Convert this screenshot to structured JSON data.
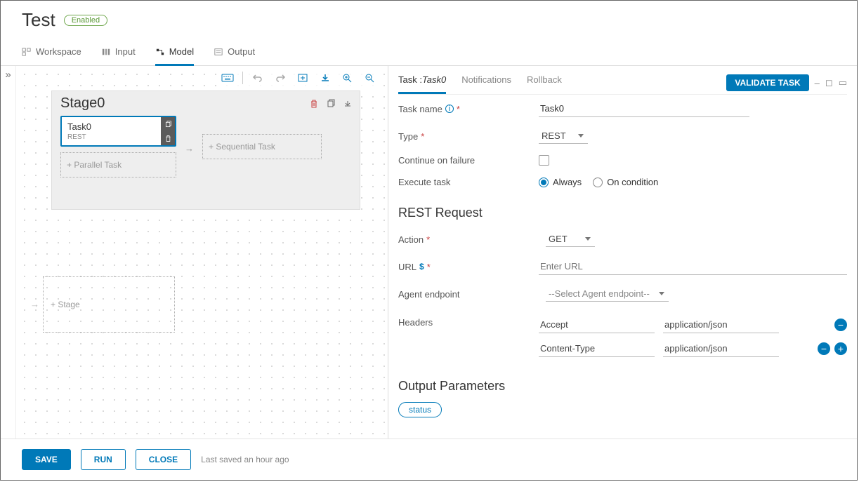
{
  "header": {
    "title": "Test",
    "status_label": "Enabled"
  },
  "tabs": [
    {
      "label": "Workspace"
    },
    {
      "label": "Input"
    },
    {
      "label": "Model"
    },
    {
      "label": "Output"
    }
  ],
  "canvas": {
    "stage_title": "Stage0",
    "task_name": "Task0",
    "task_type": "REST",
    "parallel_placeholder": "+ Parallel Task",
    "sequential_placeholder": "+ Sequential Task",
    "stage_placeholder": "+ Stage"
  },
  "details": {
    "tab_task_prefix": "Task :",
    "tab_task_name": "Task0",
    "tab_notifications": "Notifications",
    "tab_rollback": "Rollback",
    "validate_label": "VALIDATE TASK",
    "labels": {
      "task_name": "Task name",
      "type": "Type",
      "continue": "Continue on failure",
      "execute": "Execute task",
      "action": "Action",
      "url": "URL",
      "agent": "Agent endpoint",
      "headers": "Headers"
    },
    "values": {
      "task_name": "Task0",
      "type": "REST",
      "action": "GET",
      "url_placeholder": "Enter URL",
      "agent_placeholder": "--Select Agent endpoint--",
      "radio_always": "Always",
      "radio_oncondition": "On condition"
    },
    "section_rest": "REST Request",
    "section_output": "Output Parameters",
    "headers_list": [
      {
        "key": "Accept",
        "val": "application/json"
      },
      {
        "key": "Content-Type",
        "val": "application/json"
      }
    ],
    "output_params": [
      "status"
    ]
  },
  "footer": {
    "save": "SAVE",
    "run": "RUN",
    "close": "CLOSE",
    "last_saved": "Last saved an hour ago"
  }
}
